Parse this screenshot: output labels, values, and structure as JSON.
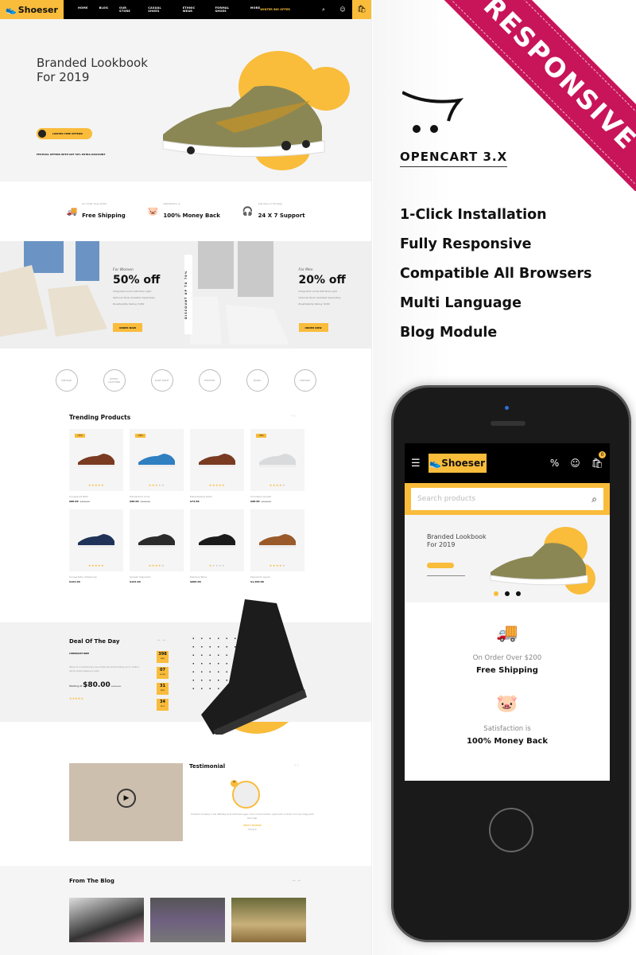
{
  "desktop": {
    "nav": {
      "logo": "Shoeser",
      "links": [
        "HOME",
        "BLOG",
        "OUR STORE",
        "CASUAL SHOES",
        "ETHNIC WEAR",
        "FORMAL SHOES",
        "MORE"
      ],
      "promo": "WINTER BIG OFFER",
      "icons": [
        "search-icon",
        "user-icon",
        "cart-icon"
      ]
    },
    "hero": {
      "title_line1": "Branded Lookbook",
      "title_line2": "For 2019",
      "pill_label": "LIMITED TIME OFFERS!",
      "note": "FESTIVAL OFFERS WITH GET 50% EXTRA DISCOUNT"
    },
    "features": [
      {
        "icon": "truck-icon",
        "sub": "On Order Over $200",
        "title": "Free Shipping"
      },
      {
        "icon": "piggy-bank-icon",
        "sub": "Satisfaction is",
        "title": "100% Money Back"
      },
      {
        "icon": "headset-icon",
        "sub": "Call Only In 30 Days",
        "title": "24 X 7 Support"
      }
    ],
    "banners": [
      {
        "eyebrow": "For Women",
        "headline": "50% off",
        "bullets": [
          "Integrated Lumia 620 Now Light",
          "Optional Nook Available Separately",
          "Breathability Rating 70/80"
        ],
        "button": "ORDER NOW"
      },
      {
        "eyebrow": "For Men",
        "headline": "20% off",
        "bullets": [
          "Integrated Lumia 620 Now Light",
          "Optional Nook Available Separately",
          "Breathability Rating 70/80"
        ],
        "button": "ORDER NOW"
      }
    ],
    "vertical_tag": "DISCOUNT UP TO 70%",
    "brands": [
      "VINTAGE",
      "RETRO CLOTHING",
      "SURF WAVE",
      "HIPSTER",
      "JEANS",
      "VINTAGE"
    ],
    "trending": {
      "title": "Trending Products",
      "products": [
        {
          "tag": "-15%",
          "name": "Consequat Nibh",
          "price": "$80.00",
          "old": "$100.00",
          "rating": 5
        },
        {
          "tag": "-20%",
          "name": "Elementum Urna",
          "price": "$90.00",
          "old": "$120.00",
          "rating": 3
        },
        {
          "tag": "",
          "name": "Pellentesque Diam",
          "price": "$74.00",
          "old": "",
          "rating": 5
        },
        {
          "tag": "-30%",
          "name": "Convallis Laoreet",
          "price": "$98.00",
          "old": "$140.00",
          "rating": 4
        },
        {
          "tag": "",
          "name": "Consectetur Adipiscing",
          "price": "$122.00",
          "old": "",
          "rating": 5
        },
        {
          "tag": "",
          "name": "Aenean Dignissim",
          "price": "$122.00",
          "old": "",
          "rating": 4
        },
        {
          "tag": "",
          "name": "Dapibus Tellus",
          "price": "$606.00",
          "old": "",
          "rating": 1
        },
        {
          "tag": "",
          "name": "Dignissim Ligula",
          "price": "$1,200.00",
          "old": "",
          "rating": 4
        }
      ]
    },
    "deal": {
      "title": "Deal Of The Day",
      "subtitle": "CONSEQUAT NIBH",
      "description": "iPhone is a revolutionary new mobile phone that allows you to make a call by simply tapping a name",
      "starting_label": "Starting At",
      "price": "$80.00",
      "old_price": "$302.00",
      "rating": 5,
      "timer": [
        {
          "value": "398",
          "unit": "DAYS"
        },
        {
          "value": "07",
          "unit": "HOURS"
        },
        {
          "value": "31",
          "unit": "MINS"
        },
        {
          "value": "34",
          "unit": "SECS"
        }
      ]
    },
    "testimonial": {
      "title": "Testimonial",
      "quote": "Excellent Company! I will definitely work with them again. Good communication, great work on time! I am very happy with their help.",
      "name": "MACY ROSAN",
      "role": "Designer"
    },
    "blog": {
      "title": "From The Blog"
    }
  },
  "promo": {
    "ribbon": "RESPONSIVE",
    "platform": "OPENCART 3.X",
    "features": [
      "1-Click Installation",
      "Fully Responsive",
      "Compatible All Browsers",
      "Multi Language",
      "Blog Module"
    ]
  },
  "mobile": {
    "logo": "Shoeser",
    "cart_count": "0",
    "search_placeholder": "Search products",
    "hero_line1": "Branded Lookbook",
    "hero_line2": "For 2019",
    "features": [
      {
        "icon": "truck-icon",
        "sub": "On Order Over $200",
        "title": "Free Shipping"
      },
      {
        "icon": "piggy-bank-icon",
        "sub": "Satisfaction is",
        "title": "100% Money Back"
      }
    ]
  },
  "colors": {
    "accent": "#f9bc3b",
    "ribbon": "#c8155a",
    "dark": "#000000"
  }
}
